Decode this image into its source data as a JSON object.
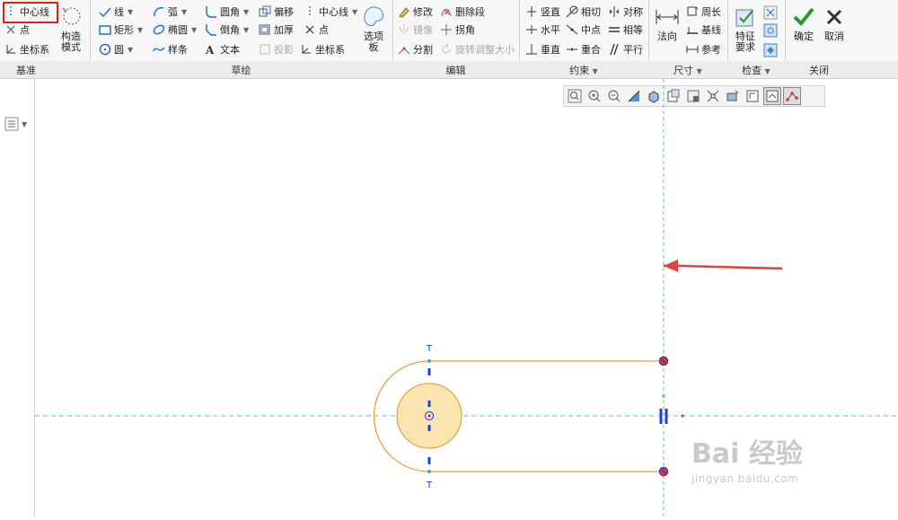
{
  "ribbon": {
    "base": {
      "centerline": "中心线",
      "point": "点",
      "coordsys": "坐标系",
      "construction_mode": "构造\n模式",
      "group_label": "基准"
    },
    "sketch": {
      "line": "线",
      "arc": "弧",
      "fillet": "圆角",
      "offset": "偏移",
      "centerline": "中心线",
      "rectangle": "矩形",
      "ellipse": "椭圆",
      "chamfer": "倒角",
      "thicken": "加厚",
      "point": "点",
      "circle": "圆",
      "spline": "样条",
      "text": "文本",
      "project": "投影",
      "coordsys": "坐标系",
      "palette": "选项\n板",
      "group_label": "草绘"
    },
    "edit": {
      "modify": "修改",
      "delete_segment": "删除段",
      "mirror": "镜像",
      "corner": "拐角",
      "divide": "分割",
      "rotate_resize": "旋转调整大小",
      "group_label": "编辑"
    },
    "constrain": {
      "vertical": "竖直",
      "tangent": "相切",
      "symmetric": "对称",
      "horizontal": "水平",
      "midpoint": "中点",
      "equal": "相等",
      "perpendicular": "垂直",
      "coincident": "重合",
      "parallel": "平行",
      "group_label": "约束"
    },
    "dimension": {
      "normal": "法向",
      "perimeter": "周长",
      "baseline": "基线",
      "reference": "参考",
      "group_label": "尺寸"
    },
    "inspect": {
      "feature_requirements": "特征\n要求",
      "group_label": "检查"
    },
    "close": {
      "ok": "确定",
      "cancel": "取消",
      "group_label": "关闭"
    }
  },
  "sketch": {
    "marker_top": "T",
    "marker_bottom": "T"
  },
  "watermark": {
    "brand": "Bai 经验",
    "url": "jingyan.baidu.com"
  },
  "colors": {
    "accent_red": "#e02020",
    "sketch_orange": "#e6a23c",
    "fill_yellow": "#fae5b0",
    "centerline_cyan": "#4cc6d6",
    "constraint_blue": "#1f3fd1"
  }
}
